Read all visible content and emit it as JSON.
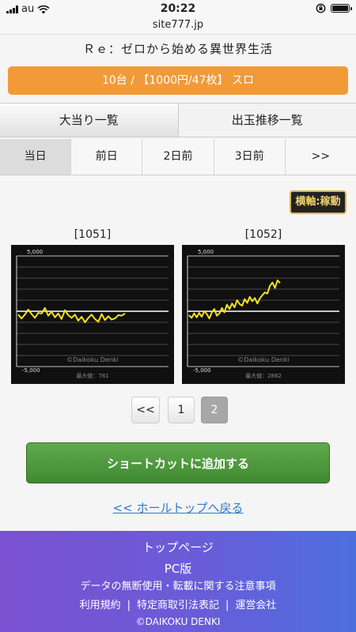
{
  "status": {
    "carrier": "au",
    "time": "20:22"
  },
  "url": "site777.jp",
  "title": "Ｒｅ：ゼロから始める異世界生活",
  "banner": "10台 / 【1000円/47枚】 スロ",
  "main_tabs": [
    "大当り一覧",
    "出玉推移一覧"
  ],
  "day_tabs": [
    "当日",
    "前日",
    "2日前",
    "3日前",
    ">>"
  ],
  "axis_toggle": "横軸:稼動",
  "machines": [
    {
      "label": "[1051]",
      "axis_top": "5,000",
      "axis_bottom": "-5,000",
      "watermark": "©Daikoku Denki",
      "max_text": "最大値：781",
      "chart_data": {
        "type": "line",
        "ylim": [
          -5000,
          5000
        ],
        "y": [
          -300,
          -650,
          -300,
          150,
          -250,
          -600,
          -150,
          -200,
          300,
          -400,
          -50,
          -550,
          -200,
          -700,
          100,
          -350,
          -600,
          -300,
          -850,
          -500,
          -1000,
          -600,
          -300,
          -700,
          -950,
          -250,
          -800,
          -450,
          -750,
          -650,
          -350,
          -400,
          -200
        ]
      }
    },
    {
      "label": "[1052]",
      "axis_top": "5,000",
      "axis_bottom": "-5,000",
      "watermark": "©Daikoku Denki",
      "max_text": "最大値：2882",
      "chart_data": {
        "type": "line",
        "ylim": [
          -5000,
          5000
        ],
        "y": [
          -350,
          -600,
          -200,
          -550,
          -150,
          -500,
          0,
          -250,
          -650,
          -100,
          200,
          -400,
          -200,
          300,
          -100,
          600,
          200,
          700,
          350,
          1000,
          650,
          500,
          1100,
          750,
          1300,
          900,
          1200,
          700,
          1150,
          1450,
          1700,
          1600,
          2300,
          2600,
          2100,
          2800,
          2550
        ]
      }
    }
  ],
  "pager": {
    "prev": "<<",
    "pages": [
      "1",
      "2"
    ],
    "current": "2"
  },
  "shortcut_button": "ショートカットに追加する",
  "back_link": "<< ホールトップへ戻る",
  "footer": {
    "top_page": "トップページ",
    "pc": "PC版",
    "notice": "データの無断使用・転載に関する注意事項",
    "links": [
      "利用規約",
      "特定商取引法表記",
      "運営会社"
    ],
    "copyright": "©DAIKOKU DENKI"
  },
  "colors": {
    "orange": "#f29a38",
    "green": "#4f9a3e",
    "link": "#2a7bd2",
    "graph_line": "#f5e21c",
    "footer_start": "#7a51d0",
    "footer_end": "#4d6fe0"
  }
}
